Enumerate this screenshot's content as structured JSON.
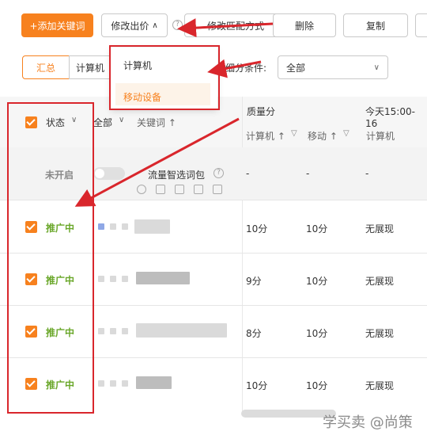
{
  "toolbar": {
    "add_keyword": "+添加关键词",
    "modify_bid": "修改出价",
    "modify_match": "修改匹配方式",
    "delete": "删除",
    "copy": "复制"
  },
  "dropdown_menu": {
    "items": [
      "计算机",
      "移动设备"
    ]
  },
  "tabs": {
    "summary": "汇总",
    "computer": "计算机"
  },
  "filter": {
    "label": "细分条件:",
    "value": "全部"
  },
  "table": {
    "headers": {
      "status": "状态",
      "all": "全部",
      "keyword": "关键词 ↑",
      "quality_score": "质量分",
      "today": "今天15:00-16",
      "qs_computer": "计算机 ↑",
      "qs_mobile": "移动 ↑",
      "today_computer": "计算机"
    },
    "special_row": {
      "status": "未开启",
      "name": "流量智选词包",
      "qs_computer": "-",
      "qs_mobile": "-",
      "today": "-"
    },
    "rows": [
      {
        "status": "推广中",
        "qs_computer": "10分",
        "qs_mobile": "10分",
        "today": "无展现"
      },
      {
        "status": "推广中",
        "qs_computer": "9分",
        "qs_mobile": "10分",
        "today": "无展现"
      },
      {
        "status": "推广中",
        "qs_computer": "8分",
        "qs_mobile": "10分",
        "today": "无展现"
      },
      {
        "status": "推广中",
        "qs_computer": "10分",
        "qs_mobile": "10分",
        "today": "无展现"
      }
    ]
  },
  "watermark": "学买卖 @尚策",
  "colors": {
    "accent": "#f7811e",
    "annotation": "#d9262c",
    "status_on": "#6aa72a"
  }
}
